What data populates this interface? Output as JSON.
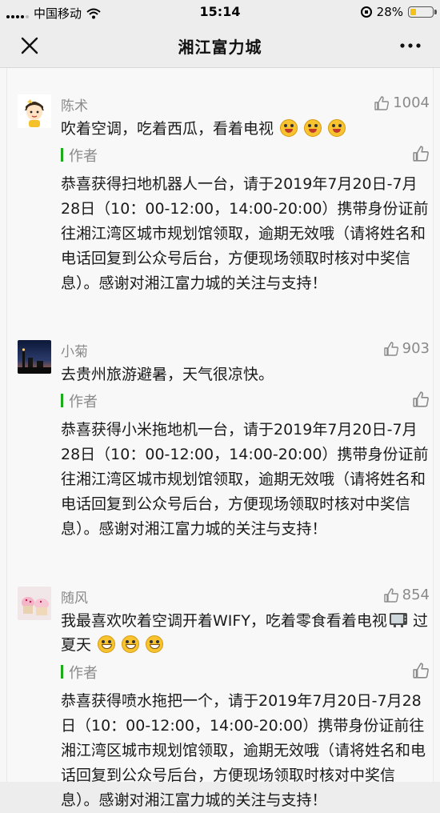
{
  "status": {
    "carrier": "中国移动",
    "time": "15:14",
    "battery_text": "28%",
    "battery_level": 0.28
  },
  "nav": {
    "title": "湘江富力城",
    "close_icon": "close-icon",
    "more_icon": "more-icon"
  },
  "colors": {
    "accent_green": "#1aad19",
    "battery_yellow": "#f2c21b"
  },
  "comments": [
    {
      "nickname": "陈术",
      "likes": "1004",
      "text": "吹着空调，吃着西瓜，看着电视",
      "emoji_icons": [
        "tongue-face-icon",
        "tongue-face-icon",
        "tongue-face-icon"
      ],
      "author_label": "作者",
      "reply": "恭喜获得扫地机器人一台，请于2019年7月20日-7月28日（10：00-12:00，14:00-20:00）携带身份证前往湘江湾区城市规划馆领取，逾期无效哦（请将姓名和电话回复到公众号后台，方便现场领取时核对中奖信息）。感谢对湘江富力城的关注与支持！"
    },
    {
      "nickname": "小菊",
      "likes": "903",
      "text": "去贵州旅游避暑，天气很凉快。",
      "author_label": "作者",
      "reply": "恭喜获得小米拖地机一台，请于2019年7月20日-7月28日（10：00-12:00，14:00-20:00）携带身份证前往湘江湾区城市规划馆领取，逾期无效哦（请将姓名和电话回复到公众号后台，方便现场领取时核对中奖信息）。感谢对湘江富力城的关注与支持！"
    },
    {
      "nickname": "随风",
      "likes": "854",
      "text": "我最喜欢吹着空调开着WIFY，吃着零食看着电视",
      "text_suffix": " 过夏天",
      "emoji_icons": [
        "tv-icon",
        "grin-face-icon",
        "grin-face-icon",
        "grin-face-icon"
      ],
      "author_label": "作者",
      "reply": "恭喜获得喷水拖把一个，请于2019年7月20日-7月28日（10：00-12:00，14:00-20:00）携带身份证前往湘江湾区城市规划馆领取，逾期无效哦（请将姓名和电话回复到公众号后台，方便现场领取时核对中奖信息）。感谢对湘江富力城的关注与支持！"
    }
  ]
}
